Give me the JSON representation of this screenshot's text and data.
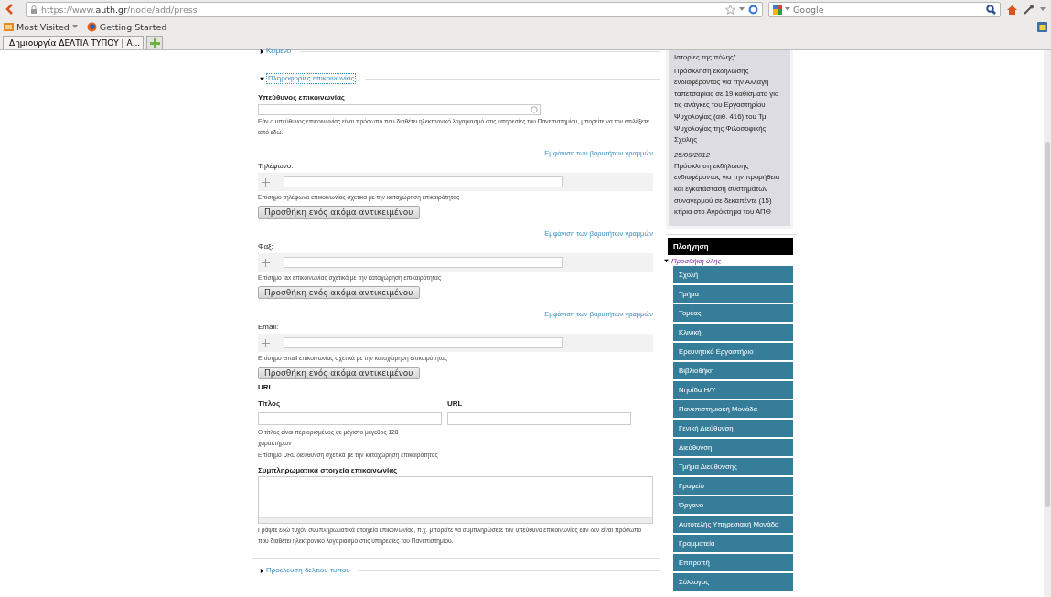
{
  "browser": {
    "url_prefix": "https://www.",
    "url_domain": "auth.gr",
    "url_path": "/node/add/press",
    "search_placeholder": "Google",
    "bookmarks": [
      "Most Visited",
      "Getting Started"
    ],
    "tabs": [
      {
        "label": "Δημιουργία ΔΕΛΤΙΑ ΤΥΠΟΥ | Α...",
        "selected": true
      }
    ]
  },
  "form": {
    "collapsed_top": {
      "label": "Κειμενο",
      "expanded": false
    },
    "contact_section": {
      "label": "Πληροφορίες επικοινωνίας",
      "expanded": true
    },
    "responsible": {
      "label": "Υπεύθυνος επικοινωνίας",
      "help": "Εάν ο υπεύθυνος επικοινωνίας είναι πρόσωπο που διαθέτει ηλεκτρονικό λογαριασμό στις υπηρεσίες του Πανεπιστημίου, μπορείτε να τον επιλέξετε από εδώ."
    },
    "multi_fields": [
      {
        "weights_link": "Εμφάνιση των βαρυτήτων γραμμών",
        "label": "Τηλέφωνο:",
        "help": "Επίσημο τηλέφωνο επικοινωνίας σχετικα με την καταχώρηση επικαιρότητας",
        "button": "Προσθήκη ενός ακόμα αντικειμένου"
      },
      {
        "weights_link": "Εμφάνιση των βαρυτήτων γραμμών",
        "label": "Φαξ:",
        "help": "Επίσημο fax επικοινωνίας σχετικά με την καταχώρηση επικαιρότητας",
        "button": "Προσθήκη ενός ακόμα αντικειμένου"
      },
      {
        "weights_link": "Εμφάνιση των βαρυτήτων γραμμών",
        "label": "Email:",
        "help": "Επίσημο email επικοινωνίας σχετικά με την καταχώρηση επικαιρότητας",
        "button": "Προσθήκη ενός ακόμα αντικειμένου"
      }
    ],
    "url_group": {
      "heading": "URL",
      "title_label": "Τίτλος",
      "url_label": "URL",
      "title_help": "Ο τίτλος είναι περιορισμένος σε μέγιστο μέγεθος 128 χαρακτήρων",
      "url_help": "Επίσημο URL διεύθυνση σχετικά με την καταχώρηση επικαιρότητας"
    },
    "extra": {
      "label": "Συμπληρωματικά στοιχεία επικοινωνίας",
      "help": "Γράψτε εδώ τυχόν συμπληρωματικά στοιχεία επικοινωνίας, π.χ. μπορείτε να συμπληρώσετε τον υπεύθυνο επικοινωνίας εάν δεν είναι πρόσωπο που διαθέτει ηλεκτρονικό λογαριασμό στις υπηρεσίες του Πανεπιστημίου."
    },
    "collapsed_bottom": {
      "label": "Προελευση δελτιου τυπου",
      "expanded": false
    }
  },
  "sidebar": {
    "news": [
      {
        "text": "Ιστορίες της πόλης\""
      },
      {
        "text": "Πρόσκληση εκδήλωσης ενδιαφέροντος για την Αλλαγή ταπετσαρίας σε 19 καθίσματα για τις ανάγκες του Εργαστηρίου Ψυχολογίας (αιθ. 416) του Τμ. Ψυχολογίας της Φιλοσοφικής Σχολής"
      },
      {
        "date": "25/09/2012",
        "text": "Πρόσκληση εκδήλωσης ενδιαφέροντος για την προμήθεια και εγκατάσταση συστημάτων συναγερμού σε δεκαπέντε (15) κτίρια στο Αγρόκτημα του ΑΠΘ"
      }
    ],
    "nav_title": "Πλοήγηση",
    "nav_parent": {
      "label": "Προσθήκη ύλης",
      "expanded": true
    },
    "nav_items": [
      "Σχολή",
      "Τμήμα",
      "Τομέας",
      "Κλινική",
      "Ερευνητικό Εργαστήριο",
      "Βιβλιοθήκη",
      "Νησίδα Η/Υ",
      "Πανεπιστημιακή Μονάδα",
      "Γενική Διεύθυνση",
      "Διεύθυνση",
      "Τμήμα Διεύθυνσης",
      "Γραφείο",
      "Όργανο",
      "Αυτοτελής Υπηρεσιακή Μονάδα",
      "Γραμματεία",
      "Επιτροπή",
      "Σύλλογος"
    ]
  }
}
